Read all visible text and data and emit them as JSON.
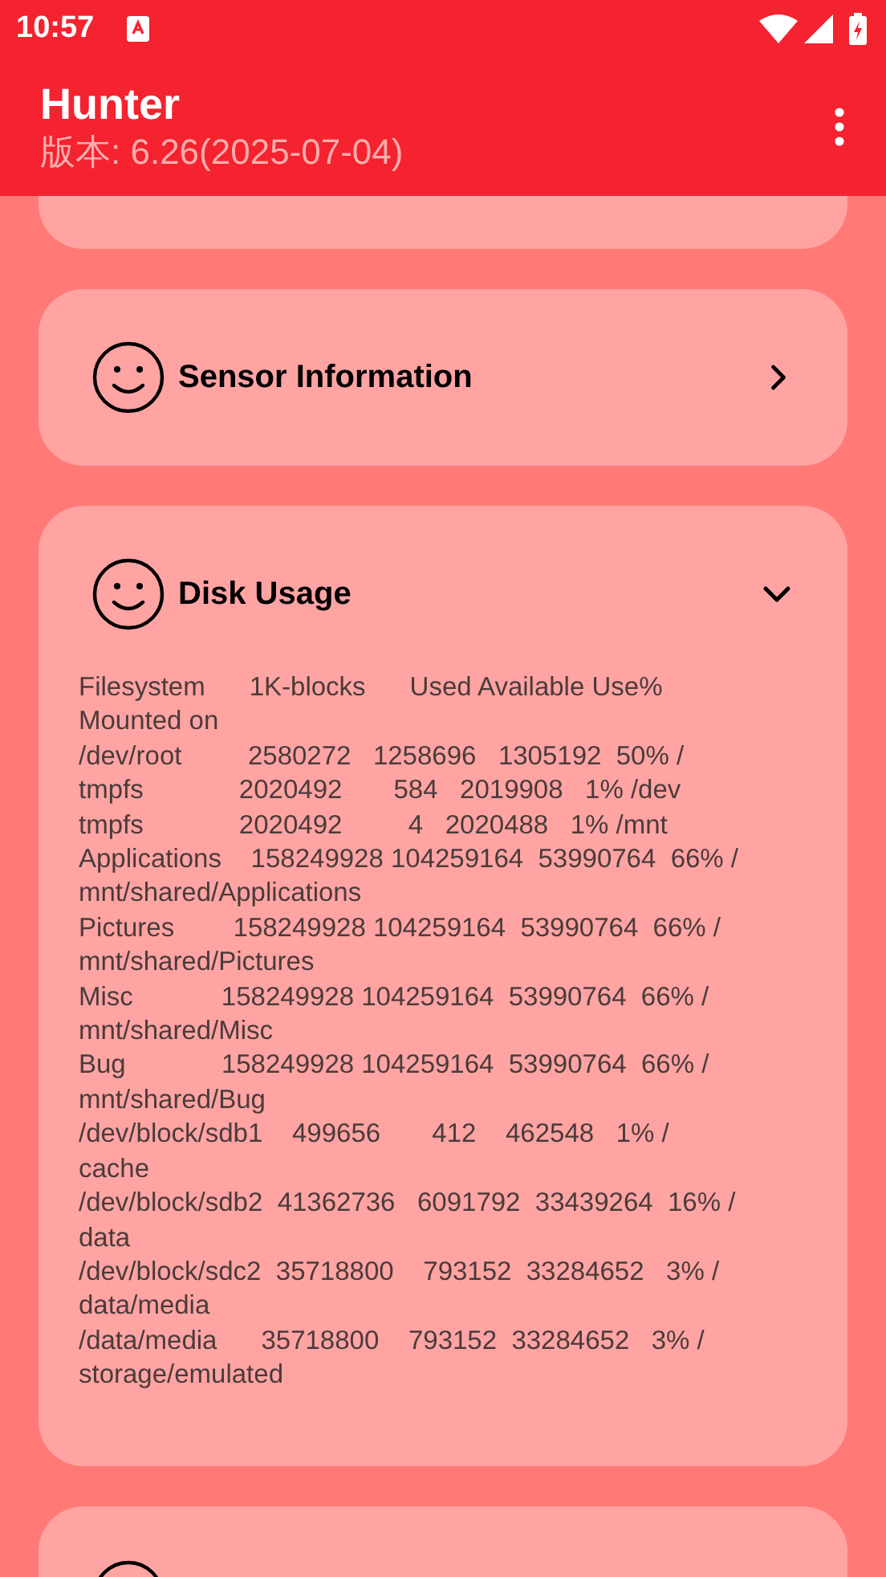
{
  "status_bar": {
    "time": "10:57"
  },
  "app_bar": {
    "title": "Hunter",
    "subtitle": "版本: 6.26(2025-07-04)"
  },
  "cards": [
    {
      "kind": "partial"
    },
    {
      "kind": "link",
      "title": "Sensor Information",
      "expanded": false
    },
    {
      "kind": "section",
      "title": "Disk Usage",
      "expanded": true,
      "lines": [
        "Filesystem      1K-blocks      Used Available Use%",
        "Mounted on",
        "/dev/root         2580272   1258696   1305192  50% /",
        "tmpfs             2020492       584   2019908   1% /dev",
        "tmpfs             2020492         4   2020488   1% /mnt",
        "Applications    158249928 104259164  53990764  66% /",
        "mnt/shared/Applications",
        "Pictures        158249928 104259164  53990764  66% /",
        "mnt/shared/Pictures",
        "Misc            158249928 104259164  53990764  66% /",
        "mnt/shared/Misc",
        "Bug             158249928 104259164  53990764  66% /",
        "mnt/shared/Bug",
        "/dev/block/sdb1    499656       412    462548   1% /",
        "cache",
        "/dev/block/sdb2  41362736   6091792  33439264  16% /",
        "data",
        "/dev/block/sdc2  35718800    793152  33284652   3% /",
        "data/media",
        "/data/media      35718800    793152  33284652   3% /",
        "storage/emulated"
      ]
    },
    {
      "kind": "partial_icon"
    }
  ]
}
